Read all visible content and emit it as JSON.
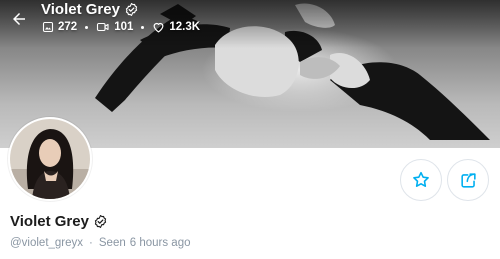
{
  "header": {
    "title": "Violet Grey",
    "stats": {
      "photos": "272",
      "videos": "101",
      "likes": "12.3K"
    }
  },
  "profile": {
    "name": "Violet Grey",
    "handle": "@violet_greyx",
    "seen_label": "Seen",
    "seen_time": "6 hours ago"
  },
  "colors": {
    "accent": "#00aff0",
    "muted_text": "#8a96a3",
    "name_text": "#1c1c1c"
  },
  "icons": {
    "back": "arrow-left-icon",
    "verified": "verified-badge-icon",
    "photos": "image-icon",
    "videos": "video-icon",
    "likes": "heart-icon",
    "favorite": "star-icon",
    "share": "share-icon"
  }
}
